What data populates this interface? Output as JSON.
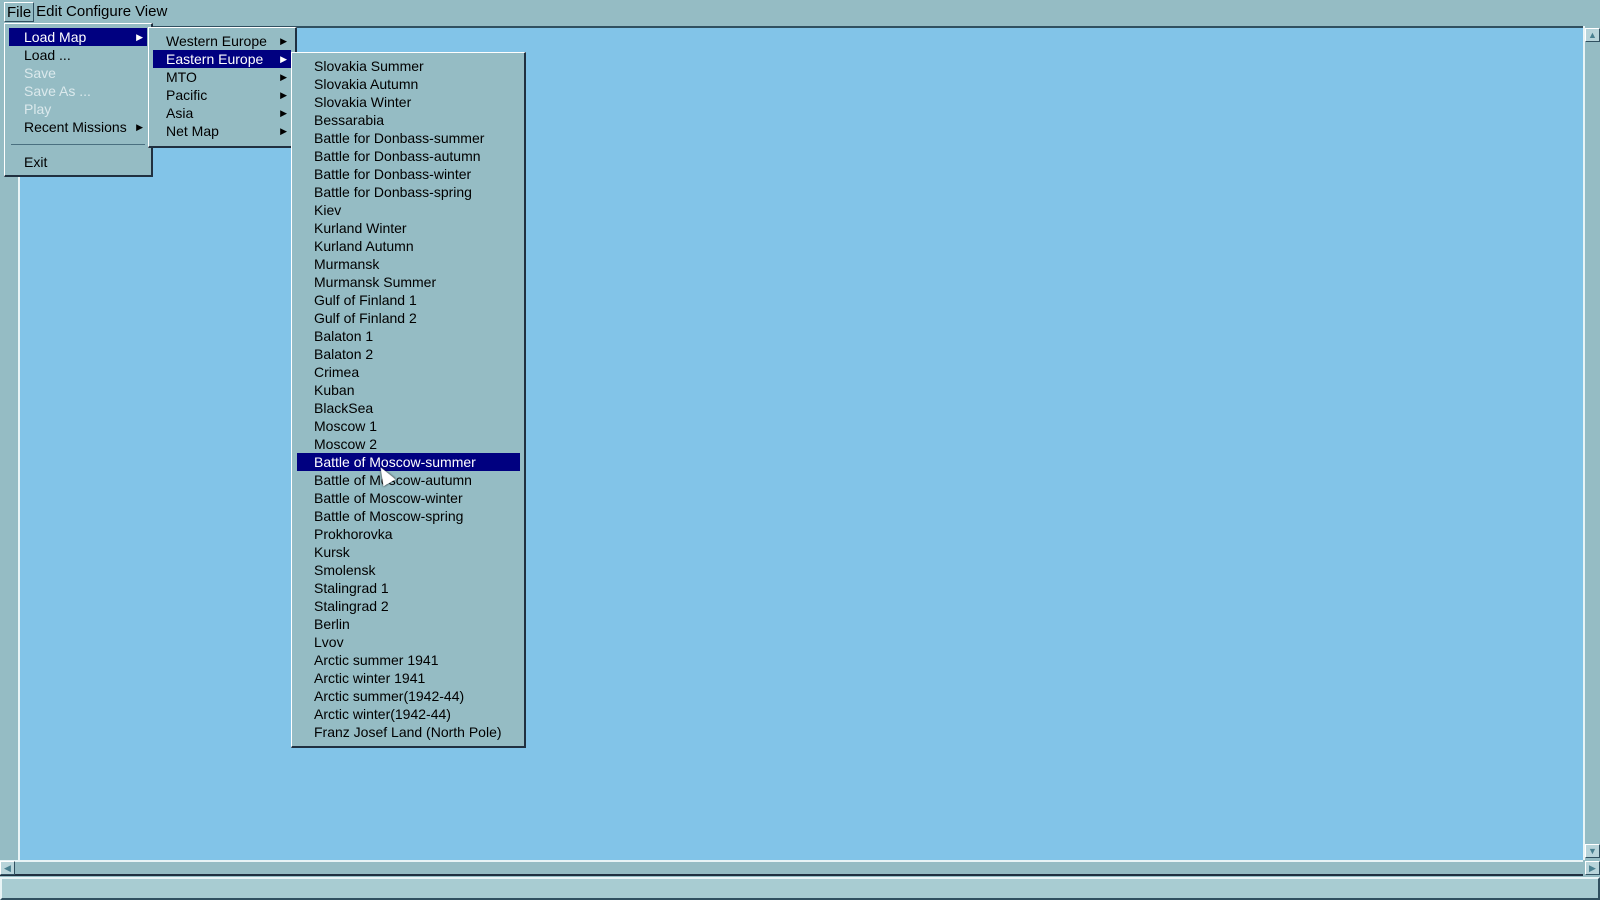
{
  "menubar": {
    "items": [
      "File",
      "Edit",
      "Configure",
      "View"
    ]
  },
  "file_menu": {
    "load_map": "Load Map",
    "load": "Load ...",
    "save": "Save",
    "save_as": "Save As ...",
    "play": "Play",
    "recent": "Recent Missions",
    "exit": "Exit"
  },
  "load_map_menu": [
    "Western Europe",
    "Eastern Europe",
    "MTO",
    "Pacific",
    "Asia",
    "Net Map"
  ],
  "eastern_europe_maps": [
    "Slovakia Summer",
    "Slovakia Autumn",
    "Slovakia Winter",
    "Bessarabia",
    "Battle for Donbass-summer",
    "Battle for Donbass-autumn",
    "Battle for Donbass-winter",
    "Battle for Donbass-spring",
    "Kiev",
    "Kurland Winter",
    "Kurland Autumn",
    "Murmansk",
    "Murmansk Summer",
    "Gulf of Finland 1",
    "Gulf of Finland 2",
    "Balaton 1",
    "Balaton 2",
    "Crimea",
    "Kuban",
    "BlackSea",
    "Moscow 1",
    "Moscow 2",
    "Battle of Moscow-summer",
    "Battle of Moscow-autumn",
    "Battle of Moscow-winter",
    "Battle of Moscow-spring",
    "Prokhorovka",
    "Kursk",
    "Smolensk",
    "Stalingrad 1",
    "Stalingrad 2",
    "Berlin",
    "Lvov",
    "Arctic summer 1941",
    "Arctic winter 1941",
    "Arctic summer(1942-44)",
    "Arctic winter(1942-44)",
    "Franz Josef Land (North Pole)"
  ],
  "selected_map_index": 22
}
